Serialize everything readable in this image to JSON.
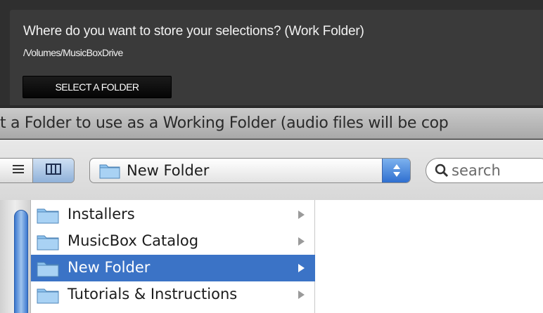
{
  "prompt": {
    "question": "Where do you want to store your selections? (Work Folder)",
    "path": "/Volumes/MusicBoxDrive",
    "select_button_label": "SELECT A FOLDER"
  },
  "dialog": {
    "title": "t a Folder to use as a Working Folder (audio files will be cop"
  },
  "toolbar": {
    "view_list_icon": "list-view-icon",
    "view_columns_icon": "column-view-icon",
    "location_popup_label": "New Folder",
    "search_placeholder": "search"
  },
  "browser": {
    "items": [
      {
        "label": "Installers",
        "selected": false
      },
      {
        "label": "MusicBox Catalog",
        "selected": false
      },
      {
        "label": "New Folder",
        "selected": true
      },
      {
        "label": "Tutorials & Instructions",
        "selected": false
      }
    ]
  },
  "colors": {
    "selection": "#3b73c6",
    "folder_icon": "#7fb6e6",
    "dark_panel": "#3a3a3a"
  }
}
